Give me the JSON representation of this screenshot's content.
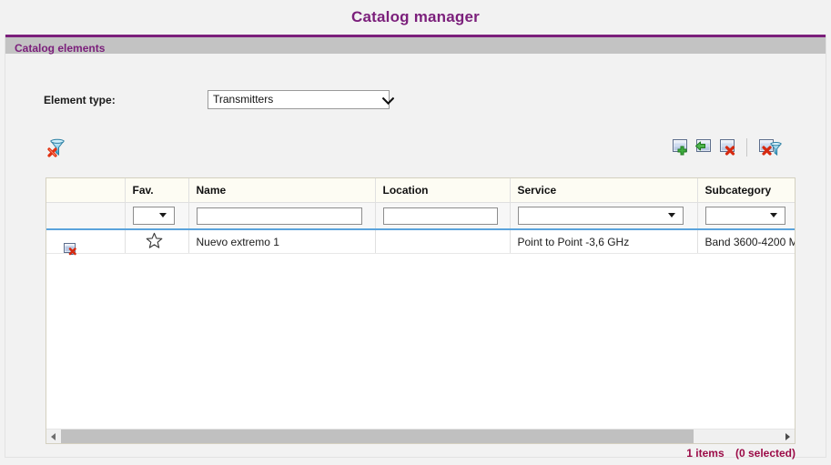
{
  "page": {
    "title": "Catalog manager",
    "title_color": "#7b1f7b"
  },
  "panel": {
    "header": "Catalog elements",
    "accent_color": "#7b1f7b",
    "header_bg": "#c3c3c3"
  },
  "form": {
    "element_type_label": "Element type:",
    "element_type_value": "Transmitters"
  },
  "toolbar": {
    "left": [
      {
        "name": "clear-filter-icon",
        "tooltip": "Clear filter"
      }
    ],
    "right": [
      {
        "name": "add-element-icon",
        "tooltip": "Add element"
      },
      {
        "name": "import-element-icon",
        "tooltip": "Import element"
      },
      {
        "name": "delete-element-icon",
        "tooltip": "Delete element"
      },
      {
        "name": "delete-filtered-icon",
        "tooltip": "Delete filtered elements"
      }
    ]
  },
  "grid": {
    "columns": [
      {
        "key": "actions",
        "header": ""
      },
      {
        "key": "fav",
        "header": "Fav."
      },
      {
        "key": "name",
        "header": "Name"
      },
      {
        "key": "location",
        "header": "Location"
      },
      {
        "key": "service",
        "header": "Service"
      },
      {
        "key": "subcategory",
        "header": "Subcategory"
      }
    ],
    "filters": {
      "fav": "",
      "name": "",
      "location": "",
      "service": "",
      "subcategory": ""
    },
    "rows": [
      {
        "fav": "star-outline-icon",
        "name": "Nuevo extremo 1",
        "location": "",
        "service": "Point to Point -3,6 GHz",
        "subcategory": "Band 3600-4200 M"
      }
    ],
    "footer": {
      "items": "1 items",
      "selected": "(0 selected)",
      "color": "#9b0b47"
    },
    "scrollbar": {
      "orientation": "horizontal",
      "thumb_position_percent": 0
    }
  }
}
